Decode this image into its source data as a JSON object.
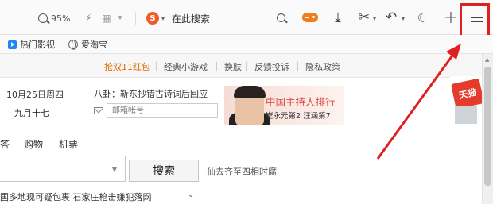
{
  "toolbar": {
    "zoom": "95%",
    "search_placeholder": "在此搜索",
    "search_engine_letter": "S"
  },
  "bookmarks": [
    {
      "label": "热门影视"
    },
    {
      "label": "爱淘宝"
    }
  ],
  "top_nav": {
    "items": [
      "抢双11红包",
      "经典小游戏",
      "换肤",
      "反馈投诉",
      "隐私政策"
    ]
  },
  "calendar": {
    "date": "10月25日周四",
    "lunar": "九月十七"
  },
  "gossip": "八卦：靳东抄错古诗词后回应",
  "mail": {
    "placeholder": "邮箱帐号"
  },
  "ad": {
    "title": "中国主持人排行",
    "subtitle": "崔永元第2 汪涵第7"
  },
  "corner_ad": {
    "label": "天猫"
  },
  "search_tabs": [
    "答",
    "购物",
    "机票"
  ],
  "search": {
    "button_label": "搜索",
    "hot_query": "仙去齐至四相时腐"
  },
  "news": {
    "text": "国多地现可疑包裹  石家庄枪击嫌犯落网"
  },
  "colors": {
    "highlight": "#e02020",
    "hot_link": "#e06a00",
    "ad_text": "#e14a4a"
  }
}
